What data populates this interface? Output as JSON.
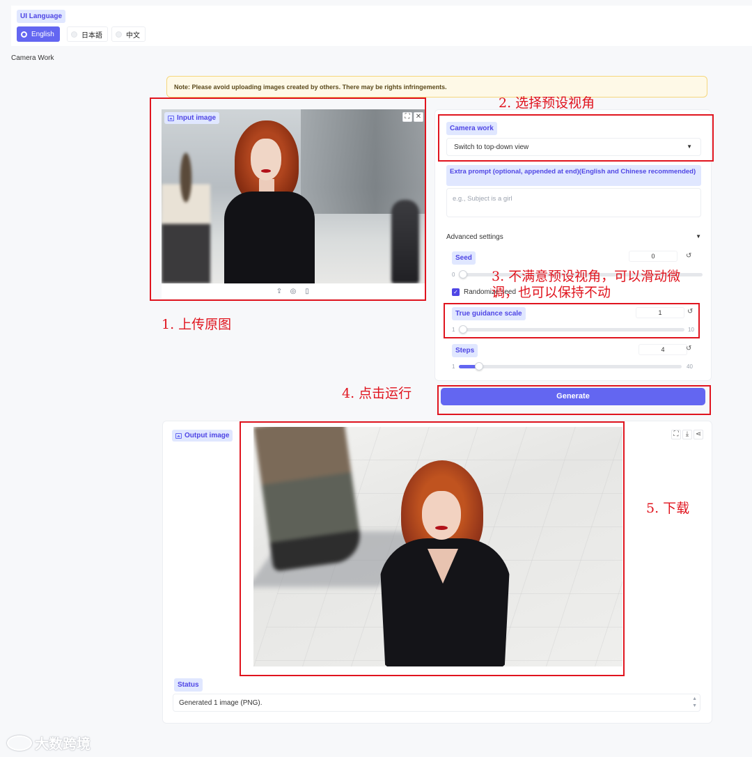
{
  "language": {
    "label": "UI Language",
    "options": [
      "English",
      "日本語",
      "中文"
    ],
    "selected": "English"
  },
  "app_title": "Camera Work",
  "note": "Note: Please avoid uploading images created by others. There may be rights infringements.",
  "input_panel": {
    "label": "Input image"
  },
  "settings": {
    "camera_work_label": "Camera work",
    "camera_work_value": "Switch to top-down view",
    "extra_prompt_label": "Extra prompt (optional, appended at end)(English and Chinese recommended)",
    "extra_prompt_placeholder": "e.g., Subject is a girl",
    "advanced_label": "Advanced settings",
    "seed": {
      "label": "Seed",
      "value": "0",
      "min": "0"
    },
    "randomize_label": "Randomize seed",
    "randomize_checked": true,
    "guidance": {
      "label": "True guidance scale",
      "value": "1",
      "min": "1",
      "max": "10",
      "fraction": 0.0
    },
    "steps": {
      "label": "Steps",
      "value": "4",
      "min": "1",
      "max": "40",
      "fraction": 0.077
    }
  },
  "generate_label": "Generate",
  "output_panel": {
    "label": "Output image"
  },
  "status": {
    "label": "Status",
    "value": "Generated 1 image (PNG)."
  },
  "annotations": {
    "step1": "1. 上传原图",
    "step2": "2. 选择预设视角",
    "step3_line1": "3. 不满意预设视角，可以滑动微",
    "step3_line2": "调，也可以保持不动",
    "step4": "4. 点击运行",
    "step5": "5. 下载"
  },
  "watermark": "大数跨境",
  "colors": {
    "accent": "#6366f1",
    "annotation": "#e0141e",
    "note_bg": "#fef9e7"
  },
  "icons": [
    "image-icon",
    "fullscreen-icon",
    "close-icon",
    "upload-icon",
    "webcam-icon",
    "clipboard-icon",
    "download-icon",
    "share-icon",
    "reset-icon",
    "chevron-down-icon"
  ]
}
